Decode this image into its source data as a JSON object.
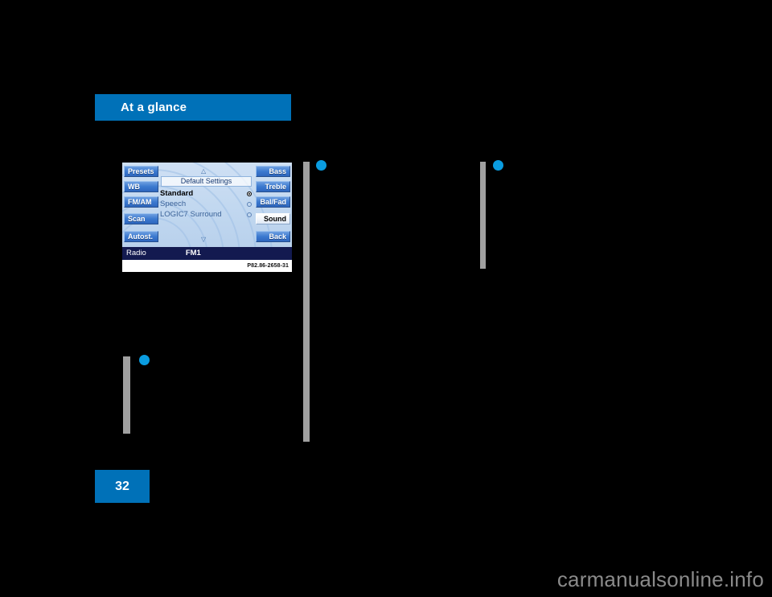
{
  "chapter": {
    "title": "At a glance"
  },
  "page": {
    "number": "32"
  },
  "figure": {
    "caption_code": "P82.86-2658-31",
    "screen": {
      "menu_title": "Default Settings",
      "arrow_up": "△",
      "arrow_down": "▽",
      "options": [
        {
          "label": "Standard",
          "selected": true
        },
        {
          "label": "Speech",
          "selected": false
        },
        {
          "label": "LOGIC7 Surround",
          "selected": false
        }
      ],
      "left_buttons": [
        {
          "label": "Presets",
          "active": false
        },
        {
          "label": "WB",
          "active": false
        },
        {
          "label": "FM/AM",
          "active": false
        },
        {
          "label": "Scan",
          "active": false
        },
        {
          "label": "Autost.",
          "active": false
        }
      ],
      "right_buttons": [
        {
          "label": "Bass",
          "active": false
        },
        {
          "label": "Treble",
          "active": false
        },
        {
          "label": "Bal/Fad",
          "active": false
        },
        {
          "label": "Sound",
          "active": true
        },
        {
          "label": "Back",
          "active": false
        }
      ],
      "status": {
        "source": "Radio",
        "band": "FM1"
      }
    }
  },
  "watermark": {
    "text": "carmanualsonline.info"
  },
  "colors": {
    "accent_blue": "#0071b8",
    "bullet_blue": "#0a9ce0",
    "rule_grey": "#a0a0a0",
    "status_navy": "#131a50"
  }
}
